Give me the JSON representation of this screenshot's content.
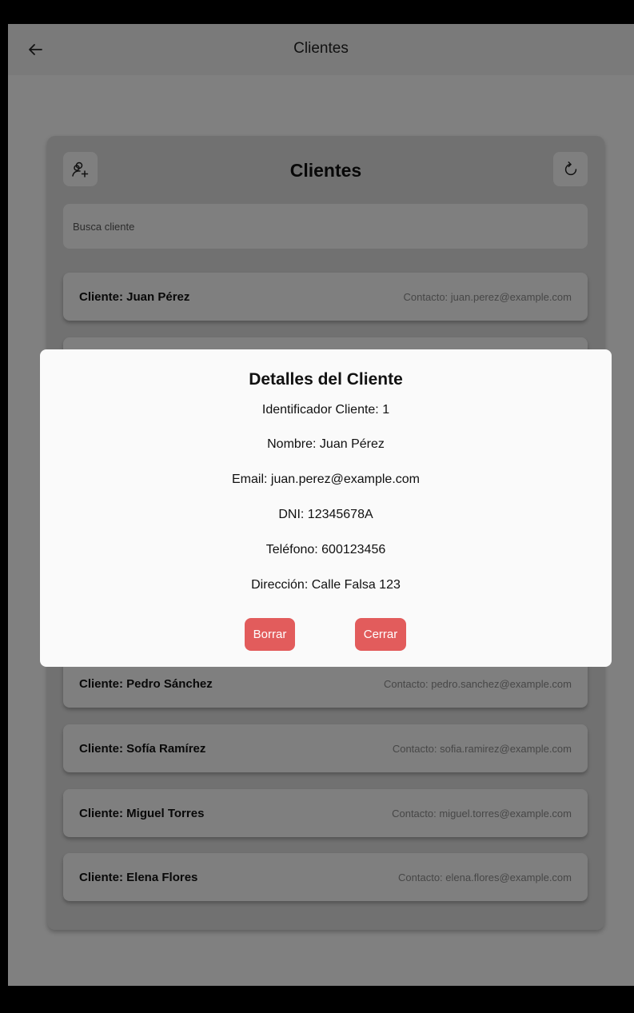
{
  "appbar": {
    "title": "Clientes",
    "back_icon": "arrow-left-icon"
  },
  "panel": {
    "title": "Clientes",
    "add_icon": "add-person-icon",
    "refresh_icon": "refresh-icon",
    "search_placeholder": "Busca cliente"
  },
  "clients": [
    {
      "name": "Cliente: Juan Pérez",
      "contact": "Contacto: juan.perez@example.com"
    },
    {
      "name": "Cliente: Pedro Sánchez",
      "contact": "Contacto: pedro.sanchez@example.com"
    },
    {
      "name": "Cliente: Sofía Ramírez",
      "contact": "Contacto: sofia.ramirez@example.com"
    },
    {
      "name": "Cliente: Miguel Torres",
      "contact": "Contacto: miguel.torres@example.com"
    },
    {
      "name": "Cliente: Elena Flores",
      "contact": "Contacto: elena.flores@example.com"
    }
  ],
  "dialog": {
    "title": "Detalles del Cliente",
    "id": "Identificador Cliente: 1",
    "nombre": "Nombre: Juan Pérez",
    "email": "Email: juan.perez@example.com",
    "dni": "DNI: 12345678A",
    "telefono": "Teléfono: 600123456",
    "direccion": "Dirección: Calle Falsa 123",
    "delete_label": "Borrar",
    "close_label": "Cerrar"
  },
  "colors": {
    "danger": "#e25c5c"
  }
}
